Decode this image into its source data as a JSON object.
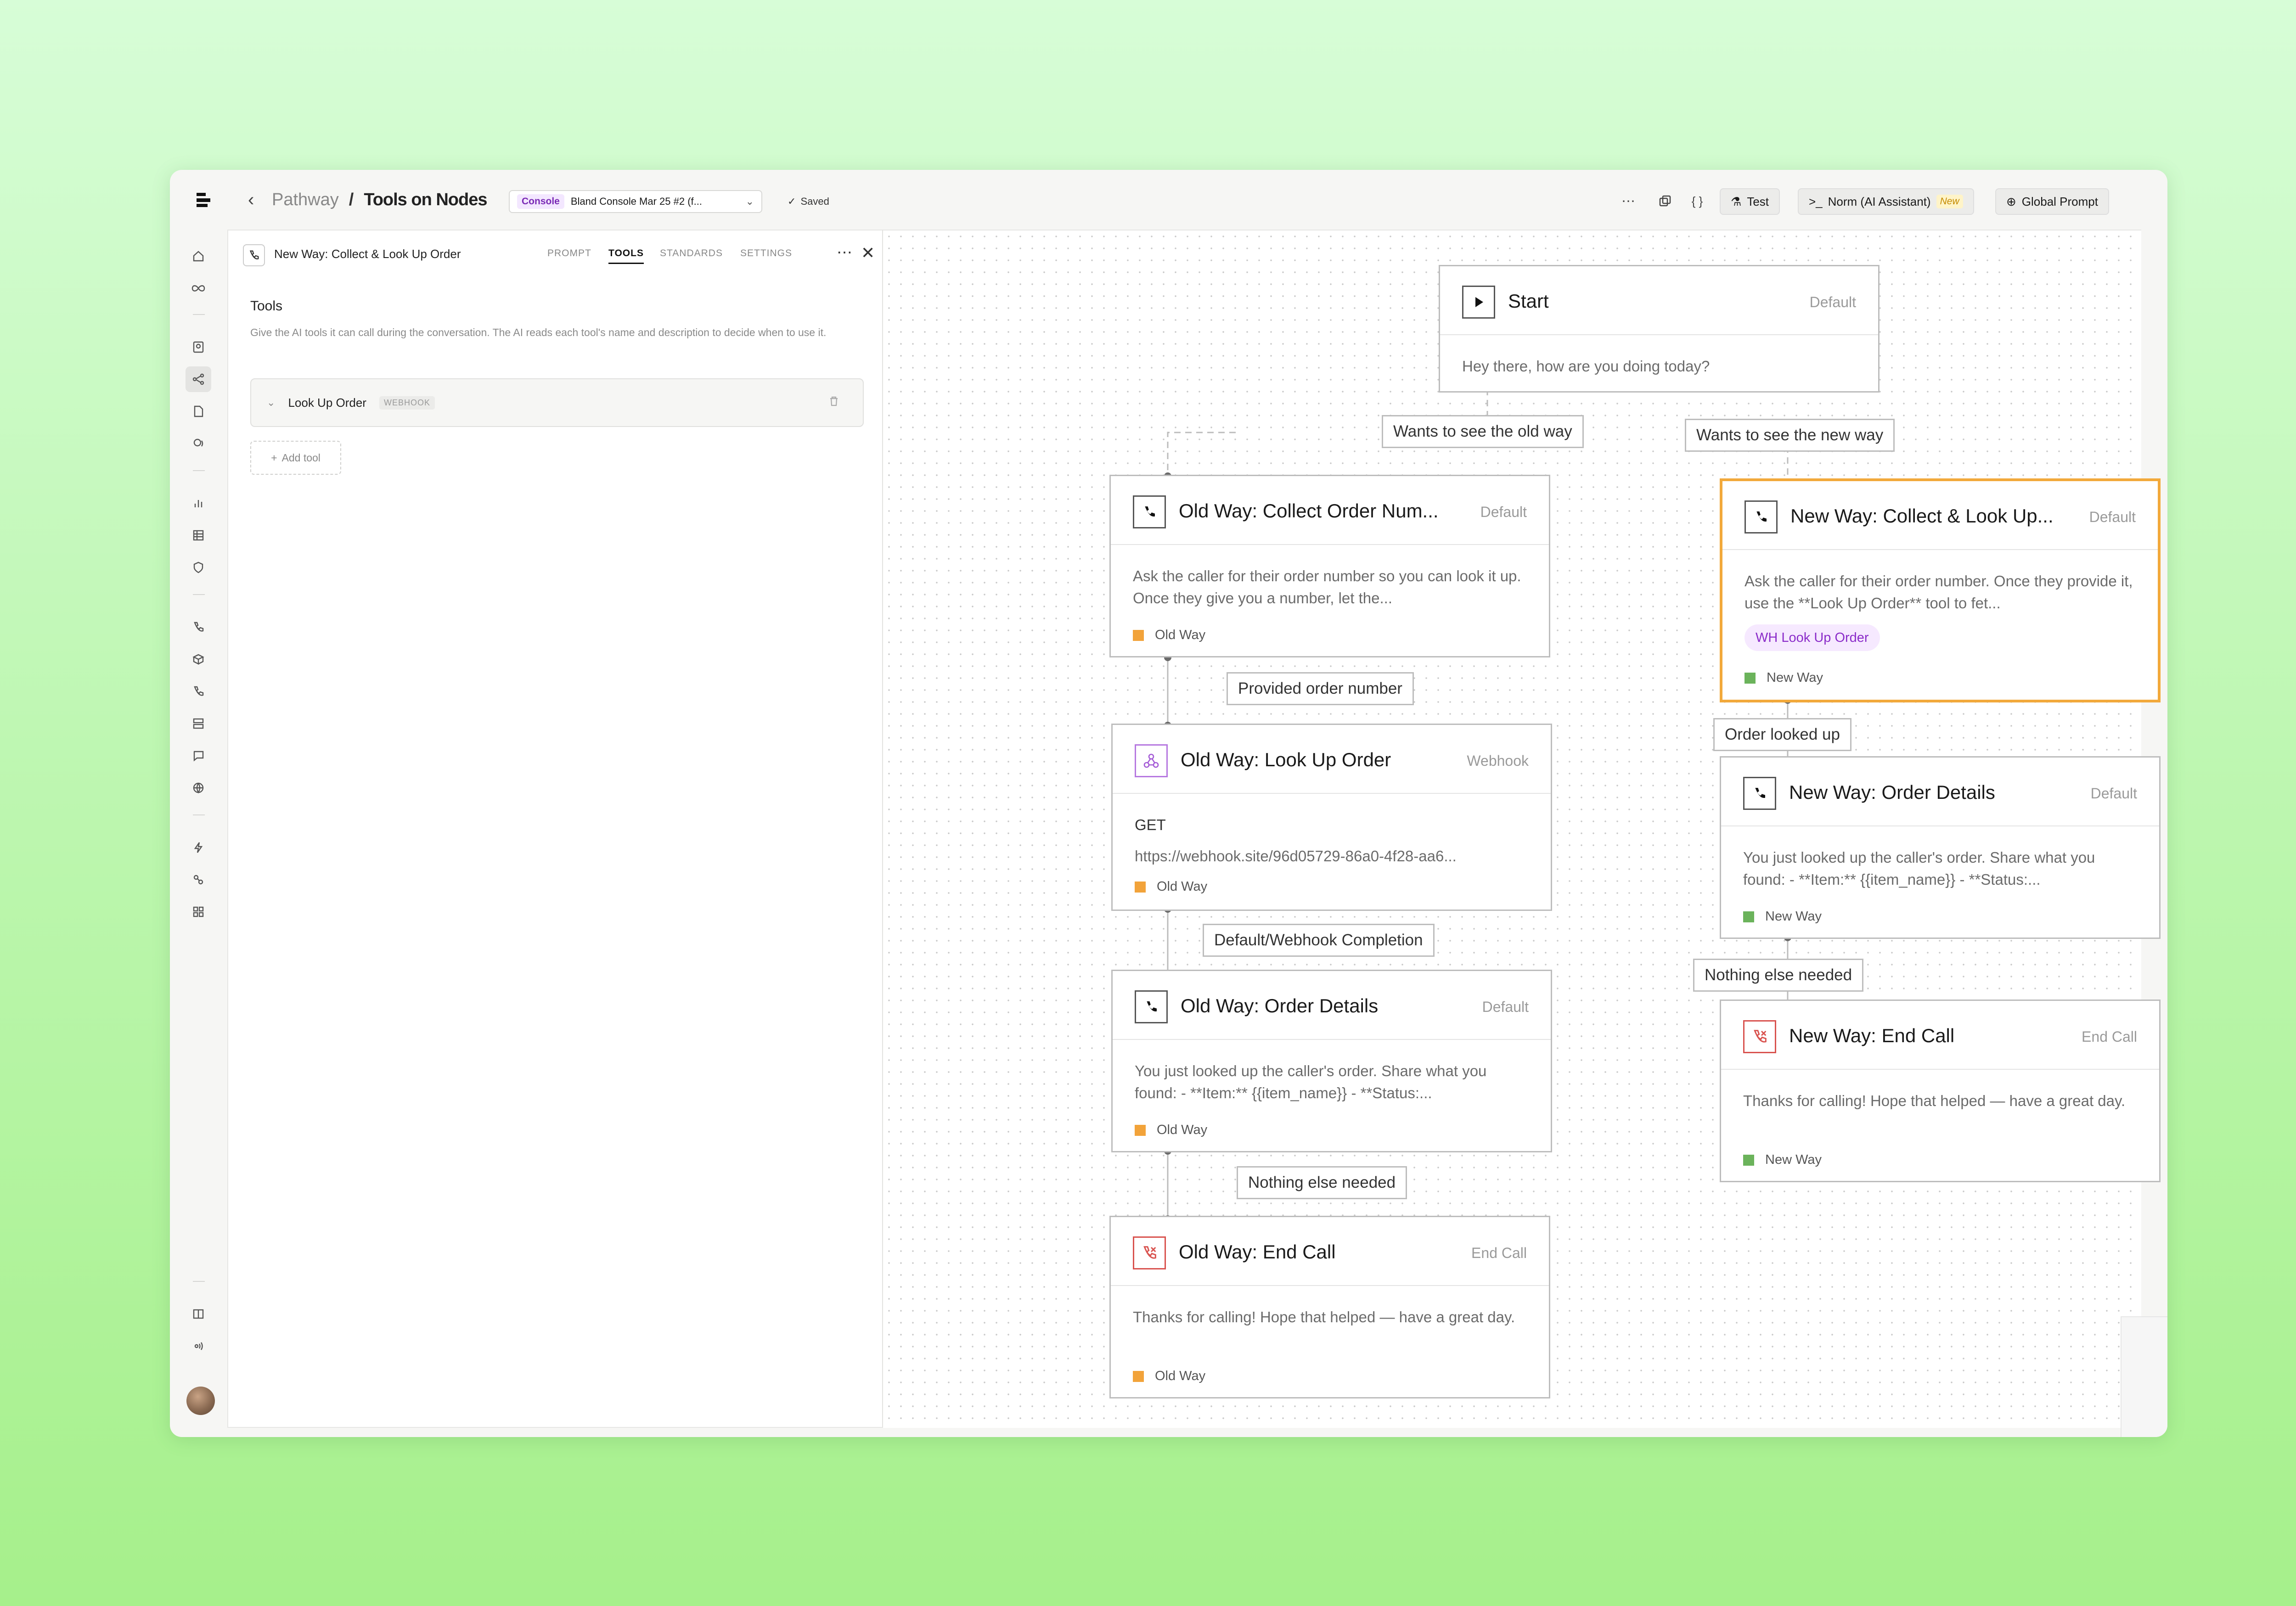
{
  "header": {
    "breadcrumb_parent": "Pathway",
    "breadcrumb_sep": "/",
    "breadcrumb_current": "Tools on Nodes",
    "console_tag": "Console",
    "console_value": "Bland Console Mar 25 #2 (f...",
    "saved_label": "Saved",
    "test_label": "Test",
    "norm_label": "Norm (AI Assistant)",
    "norm_badge": "New",
    "global_prompt_label": "Global Prompt"
  },
  "panel": {
    "title": "New Way: Collect & Look Up Order",
    "tabs": [
      "PROMPT",
      "TOOLS",
      "STANDARDS",
      "SETTINGS"
    ],
    "active_tab": "TOOLS",
    "tools_heading": "Tools",
    "tools_description": "Give the AI tools it can call during the conversation. The AI reads each tool's name and description to decide when to use it.",
    "tool_name": "Look Up Order",
    "tool_type": "WEBHOOK",
    "add_tool_label": "Add tool"
  },
  "nodes": {
    "start": {
      "title": "Start",
      "type": "Default",
      "body": "Hey there, how are you doing today?"
    },
    "old_collect": {
      "title": "Old Way: Collect Order Num...",
      "type": "Default",
      "body": "Ask the caller for their order number so you can look it up. Once they give you a number, let the...",
      "tag": "Old Way"
    },
    "old_lookup": {
      "title": "Old Way: Look Up Order",
      "type": "Webhook",
      "method": "GET",
      "url": "https://webhook.site/96d05729-86a0-4f28-aa6...",
      "tag": "Old Way"
    },
    "old_details": {
      "title": "Old Way: Order Details",
      "type": "Default",
      "body": "You just looked up the caller's order. Share what you found: - **Item:** {{item_name}} - **Status:...",
      "tag": "Old Way"
    },
    "old_end": {
      "title": "Old Way: End Call",
      "type": "End Call",
      "body": "Thanks for calling! Hope that helped — have a great day.",
      "tag": "Old Way"
    },
    "new_collect": {
      "title": "New Way: Collect & Look Up...",
      "type": "Default",
      "body": "Ask the caller for their order number. Once they provide it, use the **Look Up Order** tool to fet...",
      "tool_pill": "WH Look Up Order",
      "tag": "New Way"
    },
    "new_details": {
      "title": "New Way: Order Details",
      "type": "Default",
      "body": "You just looked up the caller's order. Share what you found: - **Item:** {{item_name}} - **Status:...",
      "tag": "New Way"
    },
    "new_end": {
      "title": "New Way: End Call",
      "type": "End Call",
      "body": "Thanks for calling! Hope that helped — have a great day.",
      "tag": "New Way"
    }
  },
  "edges": {
    "old_way": "Wants to see the old way",
    "new_way": "Wants to see the new way",
    "provided": "Provided order number",
    "webhook_completion": "Default/Webhook Completion",
    "nothing_old": "Nothing else needed",
    "looked_up": "Order looked up",
    "nothing_new": "Nothing else needed"
  },
  "colors": {
    "old_way": "#f2a33a",
    "new_way": "#6bb35b",
    "selected": "#f2a93b",
    "webhook": "#8a2bc9"
  }
}
